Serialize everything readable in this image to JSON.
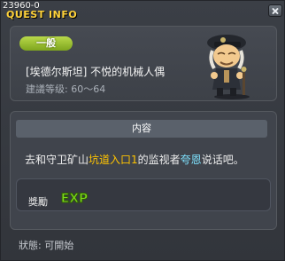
{
  "window": {
    "id_text": "23960-0",
    "title": "QUEST INFO"
  },
  "header": {
    "badge": "一般",
    "quest_name": "[埃德尔斯坦] 不悦的机械人偶",
    "level_text": "建議等级: 60～64"
  },
  "content": {
    "section_title": "内容",
    "desc_prefix": "去和守卫矿山",
    "desc_location": "坑道入口1",
    "desc_middle": "的监视者",
    "desc_npc": "夸恩",
    "desc_suffix": "说话吧。"
  },
  "reward": {
    "label": "獎勵",
    "exp_label": "EXP"
  },
  "status": {
    "text": "狀態: 可開始"
  },
  "colors": {
    "title": "#ffd23a",
    "badge": "#9bc233",
    "highlight_location": "#ffc400",
    "highlight_npc": "#7fe3ff",
    "exp": "#7cd81c"
  },
  "icons": {
    "close": "close-icon",
    "npc": "npc-portrait",
    "exp": "exp-icon"
  }
}
